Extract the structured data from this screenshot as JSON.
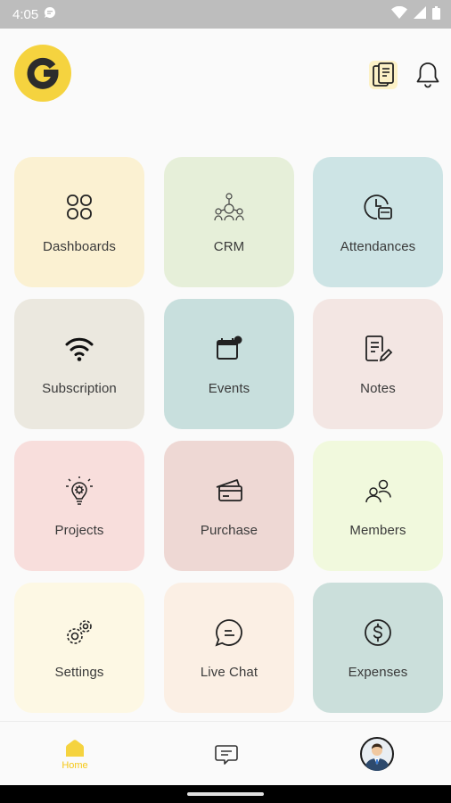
{
  "status_bar": {
    "time": "4:05"
  },
  "header": {
    "logo_letter": "G"
  },
  "tiles": [
    {
      "label": "Dashboards",
      "color": "#fbf1d2",
      "icon": "dashboard-grid-icon"
    },
    {
      "label": "CRM",
      "color": "#e6efd9",
      "icon": "crm-network-icon"
    },
    {
      "label": "Attendances",
      "color": "#cde4e5",
      "icon": "attendance-clock-icon"
    },
    {
      "label": "Subscription",
      "color": "#ebe8df",
      "icon": "wifi-icon"
    },
    {
      "label": "Events",
      "color": "#c8dfdd",
      "icon": "calendar-icon"
    },
    {
      "label": "Notes",
      "color": "#f3e6e3",
      "icon": "notes-icon"
    },
    {
      "label": "Projects",
      "color": "#f8dedc",
      "icon": "projects-lightbulb-icon"
    },
    {
      "label": "Purchase",
      "color": "#eed8d4",
      "icon": "credit-card-icon"
    },
    {
      "label": "Members",
      "color": "#f1f9dd",
      "icon": "members-icon"
    },
    {
      "label": "Settings",
      "color": "#fdf8e4",
      "icon": "gears-icon"
    },
    {
      "label": "Live Chat",
      "color": "#fbefe4",
      "icon": "chat-bubble-icon"
    },
    {
      "label": "Expenses",
      "color": "#cbdfdb",
      "icon": "dollar-coin-icon"
    }
  ],
  "bottom_nav": {
    "home_label": "Home",
    "accent": "#f5c816"
  }
}
